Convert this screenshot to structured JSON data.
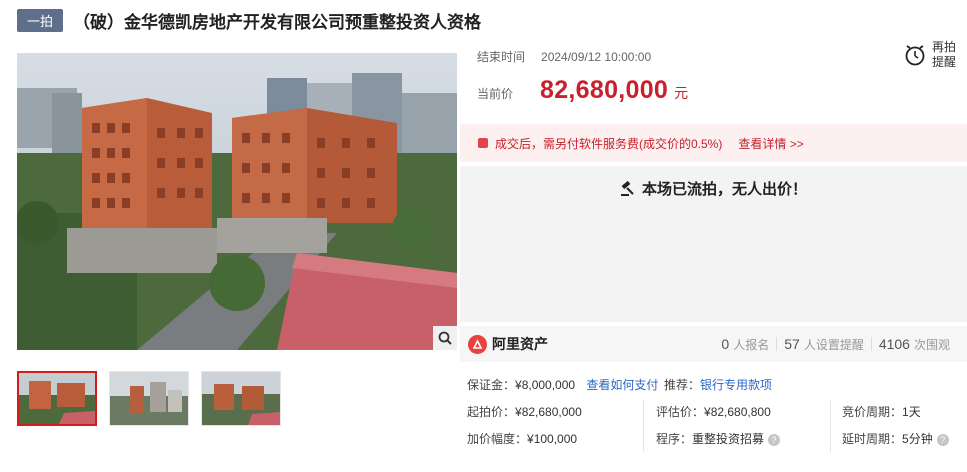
{
  "header": {
    "badge": "一拍",
    "title": "（破）金华德凯房地产开发有限公司预重整投资人资格"
  },
  "auction": {
    "end_label": "结束时间",
    "end_value": "2024/09/12 10:00:00",
    "price_label": "当前价",
    "price_value": "82,680,000",
    "price_unit": "元",
    "reminder_label": "再拍提醒",
    "fee_text": "成交后，需另付软件服务费(成交价的0.5%)",
    "fee_link": "查看详情 >>",
    "status_text": "本场已流拍，无人出价！"
  },
  "stats": {
    "brand": "阿里资产",
    "signups": "0",
    "signups_unit": "人报名",
    "reminders": "57",
    "reminders_unit": "人设置提醒",
    "views": "4106",
    "views_unit": "次围观"
  },
  "details": {
    "deposit_label": "保证金：",
    "deposit_value": "¥8,000,000",
    "deposit_link": "查看如何支付",
    "recommend_label": "推荐：",
    "recommend_link": "银行专用款项",
    "start_label": "起拍价：",
    "start_value": "¥82,680,000",
    "appraisal_label": "评估价：",
    "appraisal_value": "¥82,680,800",
    "period_label": "竞价周期：",
    "period_value": "1天",
    "increment_label": "加价幅度：",
    "increment_value": "¥100,000",
    "procedure_label": "程序：",
    "procedure_value": "重整投资招募",
    "delay_label": "延时周期：",
    "delay_value": "5分钟"
  },
  "colors": {
    "accent_red": "#c8202c",
    "badge_bg": "#5e6f8c",
    "link_blue": "#2a67c4"
  },
  "icons": {
    "zoom": "search-icon",
    "reminder": "alarm-clock-icon",
    "status": "gavel-icon",
    "fee": "fee-icon",
    "brand": "ali-asset-logo-icon",
    "help": "question-icon"
  }
}
